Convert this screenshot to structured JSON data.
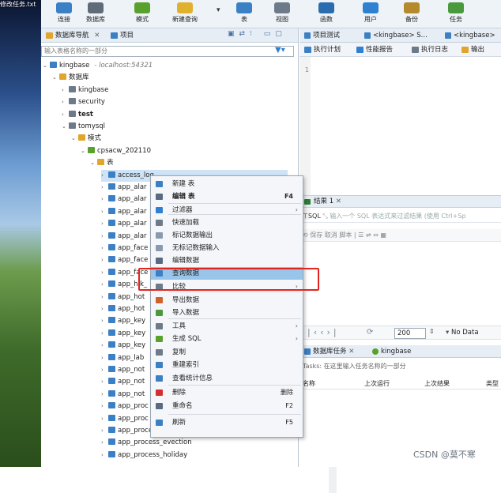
{
  "desktop": {
    "file_name": "修改任务.txt"
  },
  "toolbar": {
    "buttons": [
      {
        "label": "连接",
        "icon": "plug-icon",
        "color": "#3b7fc4"
      },
      {
        "label": "数据库",
        "icon": "database-icon",
        "color": "#5f6b78"
      },
      {
        "label": "模式",
        "icon": "schema-icon",
        "color": "#5aa02c"
      },
      {
        "label": "新建查询",
        "icon": "query-icon",
        "color": "#e0b12c"
      },
      {
        "label": "表",
        "icon": "table-icon",
        "color": "#3b7fc4"
      },
      {
        "label": "视图",
        "icon": "view-icon",
        "color": "#6d7a89"
      },
      {
        "label": "函数",
        "icon": "function-icon",
        "color": "#2b6cb0"
      },
      {
        "label": "用户",
        "icon": "user-icon",
        "color": "#2f80d1"
      },
      {
        "label": "备份",
        "icon": "backup-icon",
        "color": "#b48a2c"
      },
      {
        "label": "任务",
        "icon": "task-icon",
        "color": "#4a9a3d"
      }
    ]
  },
  "navigator": {
    "tabs": [
      {
        "label": "数据库导航"
      },
      {
        "label": "项目"
      }
    ],
    "filter_placeholder": "输入表格名称的一部分",
    "tree": {
      "root": "kingbase",
      "host": "- localhost:54321",
      "databases_label": "数据库",
      "dbs": [
        "kingbase",
        "security",
        "test",
        "tomysql"
      ],
      "schemas_label": "模式",
      "schema": "cpsacw_202110",
      "tables_label": "表",
      "tables": [
        "access_log",
        "app_alar",
        "app_alar",
        "app_alar",
        "app_alar",
        "app_alar",
        "app_face",
        "app_face",
        "app_face",
        "app_hik_",
        "app_hot",
        "app_hot",
        "app_key",
        "app_key",
        "app_key",
        "app_lab",
        "app_not",
        "app_not",
        "app_not",
        "app_proc",
        "app_proc",
        "app_process_burse_detail",
        "app_process_evection",
        "app_process_holiday"
      ]
    }
  },
  "context_menu": {
    "items": [
      {
        "label": "新建 表",
        "shortcut": "",
        "submenu": false,
        "icon": "new-table-icon",
        "color": "#3b7fc4"
      },
      {
        "label": "编辑 表",
        "shortcut": "F4",
        "submenu": false,
        "icon": "edit-icon",
        "color": "#5a6a80",
        "bold": true
      },
      {
        "label": "过滤器",
        "shortcut": "",
        "submenu": true,
        "icon": "filter-icon",
        "color": "#2f80d1"
      },
      {
        "label": "快速加载",
        "shortcut": "",
        "submenu": false,
        "icon": "clock-icon",
        "color": "#6d7a89"
      },
      {
        "label": "标记数据输出",
        "shortcut": "",
        "submenu": false,
        "icon": "export-mark-icon",
        "color": "#8a9aae"
      },
      {
        "label": "无标记数据输入",
        "shortcut": "",
        "submenu": false,
        "icon": "import-mark-icon",
        "color": "#8a9aae"
      },
      {
        "label": "编辑数据",
        "shortcut": "",
        "submenu": false,
        "icon": "edit-data-icon",
        "color": "#5a6a80"
      },
      {
        "label": "查询数据",
        "shortcut": "",
        "submenu": false,
        "icon": "query-data-icon",
        "color": "#3b7fc4"
      },
      {
        "label": "比较",
        "shortcut": "",
        "submenu": true,
        "icon": "compare-icon",
        "color": "#6d7a89"
      },
      {
        "label": "导出数据",
        "shortcut": "",
        "submenu": false,
        "icon": "export-icon",
        "color": "#d0632b"
      },
      {
        "label": "导入数据",
        "shortcut": "",
        "submenu": false,
        "icon": "import-icon",
        "color": "#4a9a3d"
      },
      {
        "label": "工具",
        "shortcut": "",
        "submenu": true,
        "icon": "wrench-icon",
        "color": "#6d7a89"
      },
      {
        "label": "生成 SQL",
        "shortcut": "",
        "submenu": true,
        "icon": "sql-icon",
        "color": "#5aa02c"
      },
      {
        "label": "复制",
        "shortcut": "",
        "submenu": false,
        "icon": "copy-icon",
        "color": "#6d7a89"
      },
      {
        "label": "重建索引",
        "shortcut": "",
        "submenu": false,
        "icon": "reindex-icon",
        "color": "#3b7fc4"
      },
      {
        "label": "查看统计信息",
        "shortcut": "",
        "submenu": false,
        "icon": "stats-icon",
        "color": "#3b7fc4"
      },
      {
        "label": "删除",
        "shortcut": "删除",
        "submenu": false,
        "icon": "delete-icon",
        "color": "#d32f2f"
      },
      {
        "label": "重命名",
        "shortcut": "F2",
        "submenu": false,
        "icon": "rename-icon",
        "color": "#5a6a80"
      },
      {
        "label": "刷新",
        "shortcut": "F5",
        "submenu": false,
        "icon": "refresh-icon",
        "color": "#3b7fc4"
      }
    ],
    "highlighted": "查询数据"
  },
  "editor": {
    "tabs": [
      {
        "label": "项目测试"
      },
      {
        "label": "<kingbase> S..."
      },
      {
        "label": "<kingbase>"
      }
    ],
    "toolbar": [
      {
        "label": "执行计划"
      },
      {
        "label": "性能报告"
      },
      {
        "label": "执行日志"
      },
      {
        "label": "输出"
      }
    ],
    "line_number": "1"
  },
  "results": {
    "tab_label": "结果 1",
    "sql_prefix": "SQL",
    "sql_placeholder": "输入一个 SQL 表达式来过滤结果 (使用 Ctrl+Sp",
    "toolbar_text": "保存   取消   脚本",
    "page_size": "200",
    "no_data": "No Data"
  },
  "tasks": {
    "tabs": [
      {
        "label": "数据库任务"
      },
      {
        "label": "kingbase"
      }
    ],
    "filter": "Tasks: 在这里输入任务名称的一部分",
    "columns": [
      "名称",
      "上次运行",
      "上次结果",
      "类型"
    ]
  },
  "watermark": "CSDN @莫不寒"
}
